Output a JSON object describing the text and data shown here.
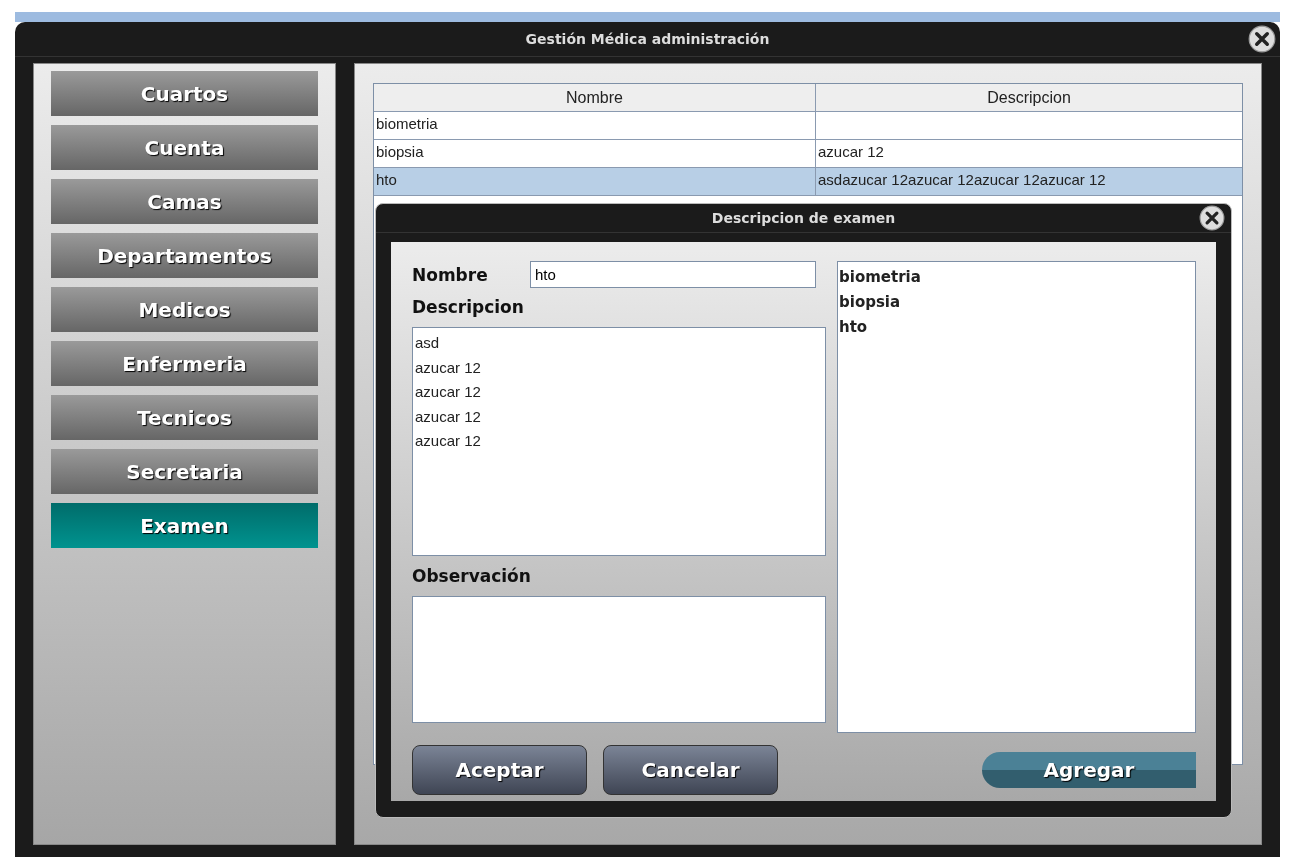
{
  "window": {
    "title": "Gestión Médica administración"
  },
  "sidebar": {
    "items": [
      {
        "label": "Cuartos",
        "selected": false
      },
      {
        "label": "Cuenta",
        "selected": false
      },
      {
        "label": "Camas",
        "selected": false
      },
      {
        "label": "Departamentos",
        "selected": false
      },
      {
        "label": "Medicos",
        "selected": false
      },
      {
        "label": "Enfermeria",
        "selected": false
      },
      {
        "label": "Tecnicos",
        "selected": false
      },
      {
        "label": "Secretaria",
        "selected": false
      },
      {
        "label": "Examen",
        "selected": true
      }
    ]
  },
  "table": {
    "columns": [
      "Nombre",
      "Descripcion"
    ],
    "rows": [
      {
        "cells": [
          "biometria",
          ""
        ],
        "selected": false
      },
      {
        "cells": [
          "biopsia",
          "azucar 12"
        ],
        "selected": false
      },
      {
        "cells": [
          "hto",
          "asdazucar 12azucar 12azucar 12azucar 12"
        ],
        "selected": true
      }
    ]
  },
  "dialog": {
    "title": "Descripcion de examen",
    "nombre_label": "Nombre",
    "nombre_value": "hto",
    "descripcion_label": "Descripcion",
    "descripcion_lines": [
      "asd",
      "azucar 12",
      "azucar 12",
      "azucar 12",
      "azucar 12"
    ],
    "observacion_label": "Observación",
    "list": [
      "biometria",
      "biopsia",
      "hto"
    ],
    "buttons": [
      "Aceptar",
      "Cancelar"
    ],
    "add_button": "Agregar"
  }
}
